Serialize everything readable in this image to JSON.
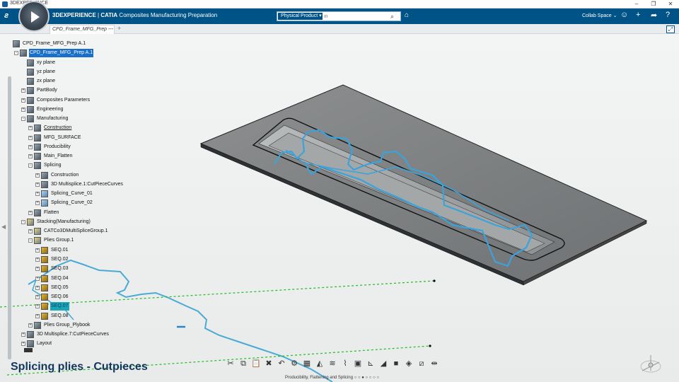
{
  "window": {
    "title": "3DEXPERIENCE"
  },
  "appbar": {
    "brand": "3DEXPERIENCE",
    "app_bold": "CATIA",
    "app_name": "Composites Manufacturing Preparation",
    "search_scope": "Physical Product",
    "search_placeholder": "in",
    "collab_space": "Collab Space"
  },
  "tabs": [
    {
      "label": "CPD_Frame_MFG_Prep ---"
    }
  ],
  "tree": [
    {
      "label": "CPD_Frame_MFG_Prep A.1",
      "depth": 0,
      "exp": ""
    },
    {
      "label": "CPD_Frame_MFG_Prep A.1",
      "depth": 1,
      "exp": "-",
      "state": "selected"
    },
    {
      "label": "xy plane",
      "depth": 2,
      "exp": ""
    },
    {
      "label": "yz plane",
      "depth": 2,
      "exp": ""
    },
    {
      "label": "zx plane",
      "depth": 2,
      "exp": ""
    },
    {
      "label": "PartBody",
      "depth": 2,
      "exp": "+"
    },
    {
      "label": "Composites Parameters",
      "depth": 2,
      "exp": "+"
    },
    {
      "label": "Engineering",
      "depth": 2,
      "exp": "+"
    },
    {
      "label": "Manufacturing",
      "depth": 2,
      "exp": "-"
    },
    {
      "label": "Construction",
      "depth": 3,
      "exp": "+",
      "state": "underline"
    },
    {
      "label": "MFG_SURFACE",
      "depth": 3,
      "exp": "+"
    },
    {
      "label": "Producibility",
      "depth": 3,
      "exp": "+"
    },
    {
      "label": "Main_Flatten",
      "depth": 3,
      "exp": "+"
    },
    {
      "label": "Splicing",
      "depth": 3,
      "exp": "-"
    },
    {
      "label": "Construction",
      "depth": 4,
      "exp": "+"
    },
    {
      "label": "3D Multisplice.1:CutPieceCurves",
      "depth": 4,
      "exp": "+"
    },
    {
      "label": "Splicing_Curve_01",
      "depth": 4,
      "exp": "+",
      "kind": "curve"
    },
    {
      "label": "Splicing_Curve_02",
      "depth": 4,
      "exp": "+",
      "kind": "curve"
    },
    {
      "label": "Flatten",
      "depth": 3,
      "exp": "+"
    },
    {
      "label": "Stacking(Manufacturing)",
      "depth": 2,
      "exp": "-",
      "kind": "ply"
    },
    {
      "label": "CATCo3DMultiSpliceGroup.1",
      "depth": 3,
      "exp": "+",
      "kind": "ply"
    },
    {
      "label": "Plies Group.1",
      "depth": 3,
      "exp": "-",
      "kind": "ply"
    },
    {
      "label": "SEQ.01",
      "depth": 4,
      "exp": "+",
      "kind": "seq"
    },
    {
      "label": "SEQ.02",
      "depth": 4,
      "exp": "+",
      "kind": "seq"
    },
    {
      "label": "SEQ.03",
      "depth": 4,
      "exp": "+",
      "kind": "seq"
    },
    {
      "label": "SEQ.04",
      "depth": 4,
      "exp": "+",
      "kind": "seq"
    },
    {
      "label": "SEQ.05",
      "depth": 4,
      "exp": "+",
      "kind": "seq"
    },
    {
      "label": "SEQ.06",
      "depth": 4,
      "exp": "+",
      "kind": "seq"
    },
    {
      "label": "SEQ.07",
      "depth": 4,
      "exp": "+",
      "kind": "seq",
      "state": "highlight"
    },
    {
      "label": "SEQ.08",
      "depth": 4,
      "exp": "+",
      "kind": "seq"
    },
    {
      "label": "Plies Group_Plybook",
      "depth": 3,
      "exp": "+"
    },
    {
      "label": "3D Multisplice.7:CutPieceCurves",
      "depth": 2,
      "exp": "+"
    },
    {
      "label": "Layout",
      "depth": 2,
      "exp": "+"
    }
  ],
  "caption": "Splicing plies - Cutpieces",
  "toolbar": {
    "section_label": "Producibility, Flattening and Splicing",
    "tools": [
      {
        "name": "cut-tool",
        "glyph": "✂"
      },
      {
        "name": "copy-tool",
        "glyph": "⧉"
      },
      {
        "name": "paste-tool",
        "glyph": "📋"
      },
      {
        "name": "delete-tool",
        "glyph": "✖"
      },
      {
        "name": "undo-tool",
        "glyph": "↶"
      },
      {
        "name": "settings-tool",
        "glyph": "⚙"
      },
      {
        "name": "grid-tool",
        "glyph": "▦"
      },
      {
        "name": "flatten-tool",
        "glyph": "◭"
      },
      {
        "name": "splice-tool",
        "glyph": "≋"
      },
      {
        "name": "curve-tool",
        "glyph": "⌇"
      },
      {
        "name": "surface-tool",
        "glyph": "▣"
      },
      {
        "name": "axis-tool",
        "glyph": "⊾"
      },
      {
        "name": "ply-tool",
        "glyph": "◢"
      },
      {
        "name": "stop-tool",
        "glyph": "■"
      },
      {
        "name": "layer-tool",
        "glyph": "◈"
      },
      {
        "name": "edit-tool",
        "glyph": "⧄"
      },
      {
        "name": "split-tool",
        "glyph": "⇹"
      }
    ]
  }
}
